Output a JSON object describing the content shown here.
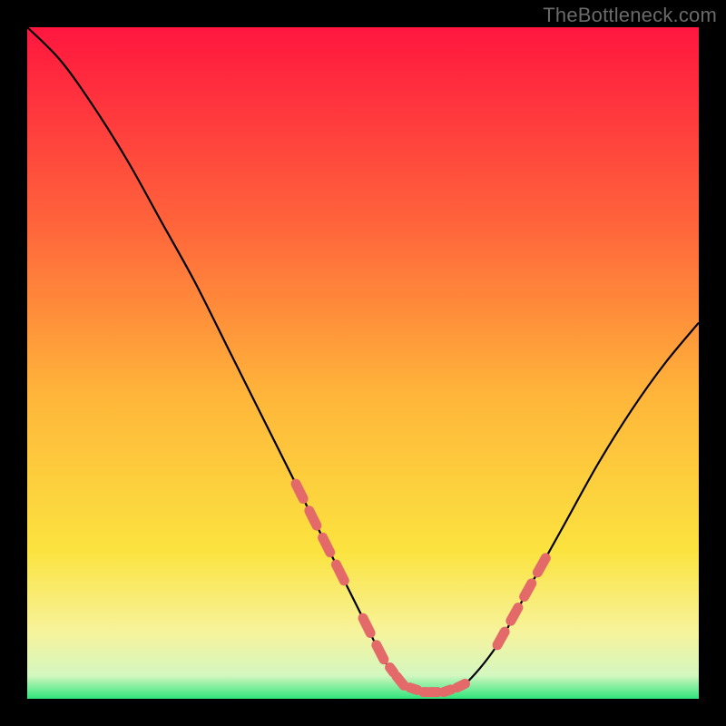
{
  "attribution": "TheBottleneck.com",
  "colors": {
    "gradient_top": "#ff163f",
    "gradient_upper": "#ff663b",
    "gradient_mid": "#ffb63a",
    "gradient_lower": "#fbe33f",
    "gradient_pale": "#f7f39b",
    "gradient_bottom": "#2fe57c",
    "curve": "#000000",
    "marker": "#e46a6a",
    "frame": "#000000"
  },
  "chart_data": {
    "type": "line",
    "title": "",
    "xlabel": "",
    "ylabel": "",
    "xlim": [
      0,
      100
    ],
    "ylim": [
      0,
      100
    ],
    "series": [
      {
        "name": "bottleneck-curve",
        "x": [
          0,
          5,
          10,
          15,
          20,
          25,
          30,
          35,
          40,
          45,
          50,
          53,
          56,
          59,
          62,
          65,
          70,
          75,
          80,
          85,
          90,
          95,
          100
        ],
        "y": [
          100,
          95,
          88,
          80,
          71,
          62,
          52,
          42,
          32,
          22,
          12,
          6,
          2,
          1,
          1,
          2,
          8,
          17,
          26,
          35,
          43,
          50,
          56
        ]
      }
    ],
    "markers": {
      "name": "highlighted-range",
      "x_clusters": [
        [
          40,
          42,
          44,
          46
        ],
        [
          50,
          52,
          54,
          55,
          57,
          59,
          60,
          62,
          64
        ],
        [
          70,
          72,
          74,
          76
        ]
      ]
    },
    "annotations": []
  }
}
